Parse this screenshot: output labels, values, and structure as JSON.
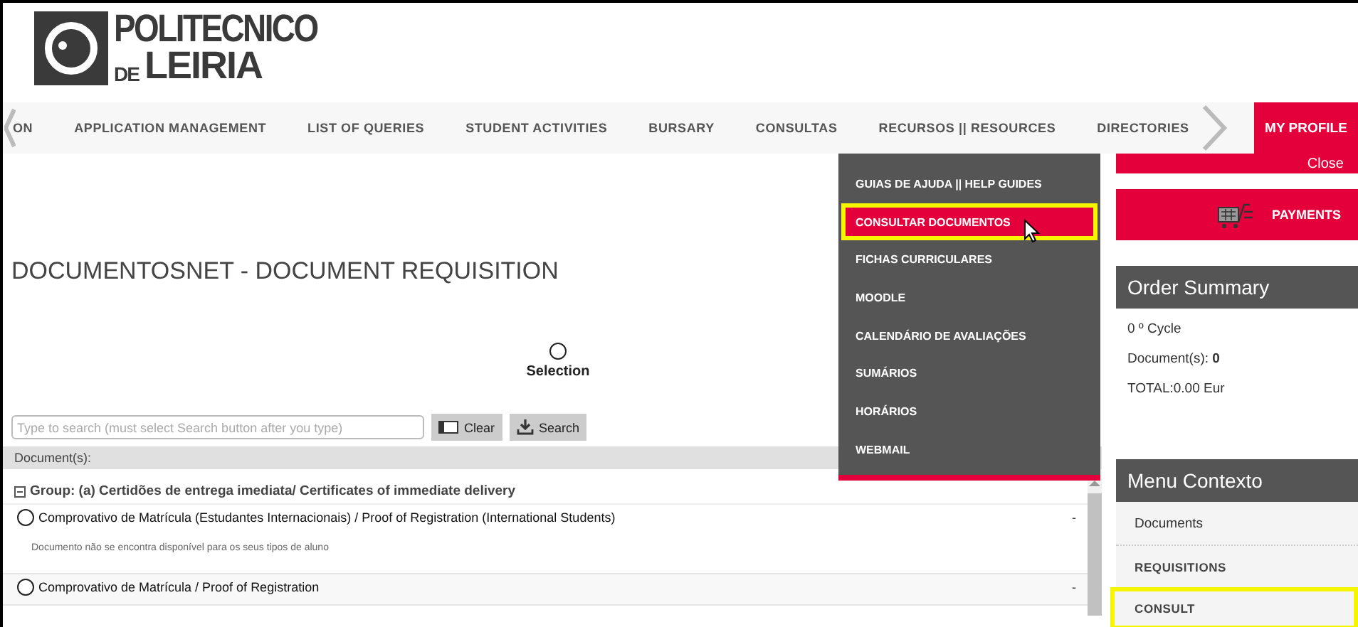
{
  "logo": {
    "line1": "POLITECNICO",
    "line2_small": "DE",
    "line2": "LEIRIA"
  },
  "nav": {
    "items": [
      {
        "label": "ON"
      },
      {
        "label": "APPLICATION MANAGEMENT"
      },
      {
        "label": "LIST OF QUERIES"
      },
      {
        "label": "STUDENT ACTIVITIES"
      },
      {
        "label": "BURSARY"
      },
      {
        "label": "CONSULTAS"
      },
      {
        "label": "RECURSOS || RESOURCES"
      },
      {
        "label": "DIRECTORIES"
      }
    ],
    "profile": "MY PROFILE"
  },
  "dropdown": {
    "items": [
      {
        "label": "GUIAS DE AJUDA || HELP GUIDES",
        "selected": false,
        "highlighted": false
      },
      {
        "label": "CONSULTAR DOCUMENTOS",
        "selected": true,
        "highlighted": true
      },
      {
        "label": "FICHAS CURRICULARES",
        "selected": false,
        "highlighted": false
      },
      {
        "label": "MOODLE",
        "selected": false,
        "highlighted": false
      },
      {
        "label": "CALENDÁRIO DE AVALIAÇÕES",
        "selected": false,
        "highlighted": false
      },
      {
        "label": "SUMÁRIOS",
        "selected": false,
        "highlighted": false
      },
      {
        "label": "HORÁRIOS",
        "selected": false,
        "highlighted": false
      },
      {
        "label": "WEBMAIL",
        "selected": false,
        "highlighted": false
      }
    ]
  },
  "main": {
    "title": "DOCUMENTOSNET - DOCUMENT REQUISITION",
    "selection": {
      "label": "Selection",
      "checked": false
    },
    "search": {
      "placeholder": "Type to search (must select Search button after you type)",
      "clear": "Clear",
      "button": "Search"
    },
    "list_header": "Document(s):",
    "group": "Group: (a) Certidões de entrega imediata/ Certificates of immediate delivery",
    "documents": [
      {
        "name": "Comprovativo de Matrícula (Estudantes Internacionais) / Proof of Registration (International Students)",
        "checked": false,
        "mark": "-",
        "note": "Documento não se encontra disponível para os seus tipos de aluno"
      },
      {
        "name": "Comprovativo de Matrícula / Proof of Registration",
        "checked": false,
        "mark": "-"
      }
    ]
  },
  "sidebar": {
    "close": "Close",
    "payments": "PAYMENTS",
    "order_summary": {
      "title": "Order Summary",
      "cycle": "0 º Cycle",
      "documents_label": "Document(s):",
      "documents_value": "0",
      "total": "TOTAL:0.00 Eur"
    },
    "menu_contexto": {
      "title": "Menu Contexto",
      "items": [
        {
          "label": "Documents",
          "highlighted": false
        },
        {
          "label": "REQUISITIONS",
          "highlighted": false
        },
        {
          "label": "CONSULT",
          "highlighted": true
        }
      ]
    }
  }
}
